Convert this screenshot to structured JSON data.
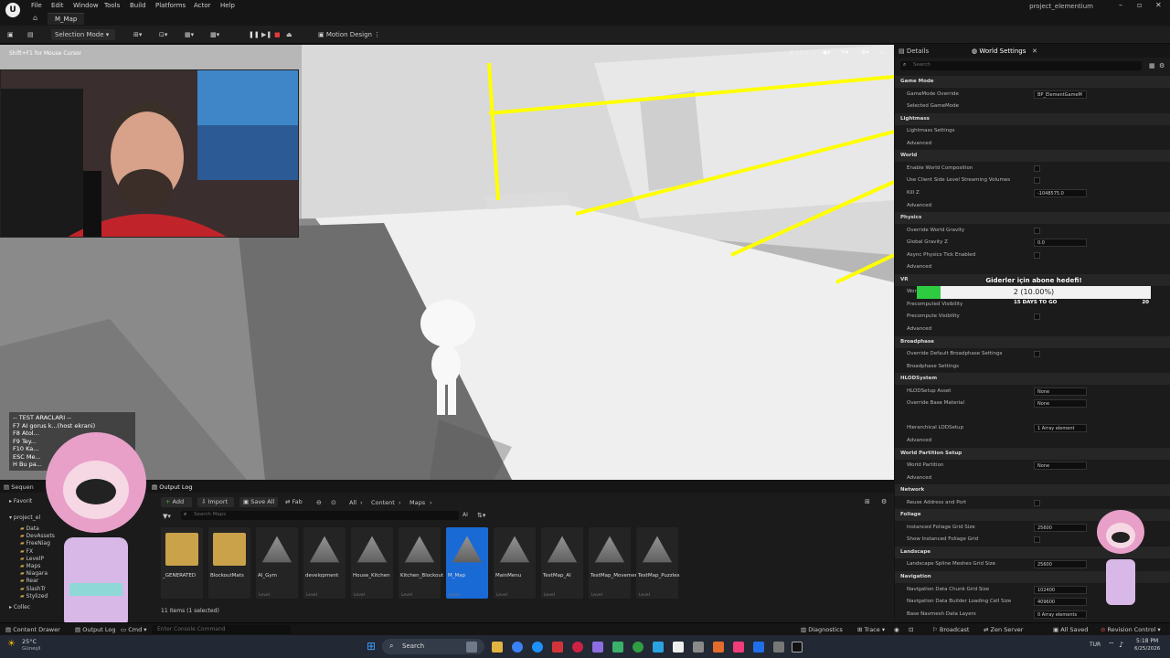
{
  "menu": [
    "File",
    "Edit",
    "Window",
    "Tools",
    "Build",
    "Platforms",
    "Actor",
    "Help"
  ],
  "tab_title": "M_Map",
  "project_name": "project_elementium",
  "toolbar": {
    "selection_mode": "Selection Mode",
    "motion_design": "Motion Design"
  },
  "viewport": {
    "hint": "Shift+F1 for Mouse Cursor",
    "lit": "Lit"
  },
  "test_overlay": {
    "title": "-- TEST ARACLARI --",
    "lines": [
      "F7  AI gorus k...(host ekrani)",
      "F8  Atol...",
      "F9  Tey...",
      "F10 Ka...",
      "ESC Me...",
      "H   Bu pa..."
    ]
  },
  "right_panel": {
    "tabs": [
      "Details",
      "World Settings"
    ],
    "search_placeholder": "Search",
    "rows": [
      {
        "type": "section",
        "label": "Game Mode"
      },
      {
        "type": "prop",
        "label": "GameMode Override",
        "value": "BP_ElementGameM"
      },
      {
        "type": "prop",
        "label": "Selected GameMode",
        "value": ""
      },
      {
        "type": "section",
        "label": "Lightmass"
      },
      {
        "type": "prop",
        "label": "Lightmass Settings",
        "value": ""
      },
      {
        "type": "prop",
        "label": "Advanced",
        "value": ""
      },
      {
        "type": "section",
        "label": "World"
      },
      {
        "type": "check",
        "label": "Enable World Composition",
        "value": ""
      },
      {
        "type": "check",
        "label": "Use Client Side Level Streaming Volumes",
        "value": ""
      },
      {
        "type": "prop",
        "label": "Kill Z",
        "value": "-1048575.0"
      },
      {
        "type": "prop",
        "label": "Advanced",
        "value": ""
      },
      {
        "type": "section",
        "label": "Physics"
      },
      {
        "type": "check",
        "label": "Override World Gravity",
        "value": ""
      },
      {
        "type": "prop",
        "label": "Global Gravity Z",
        "value": "0.0"
      },
      {
        "type": "check",
        "label": "Async Physics Tick Enabled",
        "value": ""
      },
      {
        "type": "prop",
        "label": "Advanced",
        "value": ""
      },
      {
        "type": "section",
        "label": "VR"
      },
      {
        "type": "prop",
        "label": "World",
        "value": ""
      },
      {
        "type": "prop",
        "label": "Precomputed Visibility",
        "value": ""
      },
      {
        "type": "check",
        "label": "Precompute Visibility",
        "value": ""
      },
      {
        "type": "prop",
        "label": "Advanced",
        "value": ""
      },
      {
        "type": "section",
        "label": "Broadphase"
      },
      {
        "type": "check",
        "label": "Override Default Broadphase Settings",
        "value": ""
      },
      {
        "type": "prop",
        "label": "Broadphase Settings",
        "value": ""
      },
      {
        "type": "section",
        "label": "HLODSystem"
      },
      {
        "type": "prop",
        "label": "HLODSetup Asset",
        "value": "None"
      },
      {
        "type": "prop",
        "label": "Override Base Material",
        "value": "None"
      },
      {
        "type": "prop",
        "label": "",
        "value": ""
      },
      {
        "type": "prop",
        "label": "Hierarchical LODSetup",
        "value": "1 Array element"
      },
      {
        "type": "prop",
        "label": "Advanced",
        "value": ""
      },
      {
        "type": "section",
        "label": "World Partition Setup"
      },
      {
        "type": "prop",
        "label": "World Partition",
        "value": "None"
      },
      {
        "type": "prop",
        "label": "Advanced",
        "value": ""
      },
      {
        "type": "section",
        "label": "Network"
      },
      {
        "type": "check",
        "label": "Reuse Address and Port",
        "value": ""
      },
      {
        "type": "section",
        "label": "Foliage"
      },
      {
        "type": "prop",
        "label": "Instanced Foliage Grid Size",
        "value": "25600"
      },
      {
        "type": "check",
        "label": "Show Instanced Foliage Grid",
        "value": ""
      },
      {
        "type": "section",
        "label": "Landscape"
      },
      {
        "type": "prop",
        "label": "Landscape Spline Meshes Grid Size",
        "value": "25600"
      },
      {
        "type": "section",
        "label": "Navigation"
      },
      {
        "type": "prop",
        "label": "Navigation Data Chunk Grid Size",
        "value": "102400"
      },
      {
        "type": "prop",
        "label": "Navigation Data Builder Loading Cell Size",
        "value": "409600"
      },
      {
        "type": "prop",
        "label": "Base Navmesh Data Layers",
        "value": "0 Array elements"
      }
    ]
  },
  "goal_widget": {
    "title": "Giderler için abone hedefi!",
    "value_text": "2 (10.00%)",
    "progress": 0.1,
    "days": "15 DAYS TO GO",
    "target": "20",
    "bar_color": "#2ecc40"
  },
  "output_log_tab": "Output Log",
  "sequencer_tab": "Sequen",
  "content_toolbar": {
    "add": "Add",
    "import": "Import",
    "save_all": "Save All",
    "fab": "Fab",
    "breadcrumb": [
      "All",
      "Content",
      "Maps"
    ],
    "search_placeholder": "Search Maps"
  },
  "sources": {
    "favorites": "Favorit",
    "project": "project_el",
    "folders": [
      "Data",
      "DevAssets",
      "FreeNiag",
      "FX",
      "LevelP",
      "Maps",
      "Niagara",
      "Rear",
      "SlashTr",
      "Stylized"
    ],
    "collections": "Collec"
  },
  "assets": [
    {
      "name": "_GENERATED",
      "type": "",
      "kind": "folder"
    },
    {
      "name": "BlockoutMats",
      "type": "",
      "kind": "folder"
    },
    {
      "name": "AI_Gym",
      "type": "Level",
      "kind": "level"
    },
    {
      "name": "development",
      "type": "Level",
      "kind": "level"
    },
    {
      "name": "House_Kitchen",
      "type": "Level",
      "kind": "level"
    },
    {
      "name": "Kitchen_Blockout",
      "type": "Level",
      "kind": "level"
    },
    {
      "name": "M_Map",
      "type": "Level",
      "kind": "level",
      "selected": true
    },
    {
      "name": "MainMenu",
      "type": "Level",
      "kind": "level"
    },
    {
      "name": "TestMap_AI",
      "type": "Level",
      "kind": "level"
    },
    {
      "name": "TestMap_Movement",
      "type": "Level",
      "kind": "level"
    },
    {
      "name": "TestMap_Puzzles",
      "type": "Level",
      "kind": "level"
    }
  ],
  "items_count": "11 items (1 selected)",
  "status_bar": {
    "content_drawer": "Content Drawer",
    "output_log": "Output Log",
    "cmd": "Cmd",
    "console_placeholder": "Enter Console Command",
    "diagnostics": "Diagnostics",
    "trace": "Trace",
    "broadcast": "Broadcast",
    "zen_server": "Zen Server",
    "all_saved": "All Saved",
    "revision_control": "Revision Control"
  },
  "taskbar": {
    "weather_temp": "25°C",
    "weather_desc": "Güneşli",
    "search": "Search",
    "lang": "TUR",
    "time": "5:18 PM",
    "date": "6/25/2026"
  }
}
